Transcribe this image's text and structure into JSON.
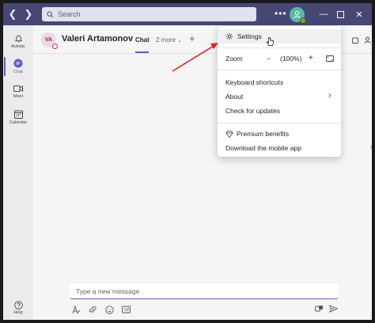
{
  "titlebar": {
    "search_placeholder": "Search",
    "more_label": "•••"
  },
  "rail": {
    "items": [
      {
        "label": "Activity",
        "icon": "bell-icon"
      },
      {
        "label": "Chat",
        "icon": "chat-icon"
      },
      {
        "label": "Meet",
        "icon": "video-icon"
      },
      {
        "label": "Calendar",
        "icon": "calendar-icon"
      }
    ],
    "help_label": "Help"
  },
  "chat": {
    "contact_initials": "VA",
    "contact_name": "Valeri Artamonov",
    "tab_chat": "Chat",
    "tab_more": "2 more",
    "compose_placeholder": "Type a new message"
  },
  "menu": {
    "settings": "Settings",
    "zoom_label": "Zoom",
    "zoom_minus": "−",
    "zoom_value": "(100%)",
    "zoom_plus": "+",
    "keyboard_shortcuts": "Keyboard shortcuts",
    "about": "About",
    "check_updates": "Check for updates",
    "premium": "Premium benefits",
    "download_mobile": "Download the mobile app"
  },
  "colors": {
    "titlebar": "#464775",
    "accent": "#5b5fc7",
    "annotation_arrow": "#e02020"
  }
}
